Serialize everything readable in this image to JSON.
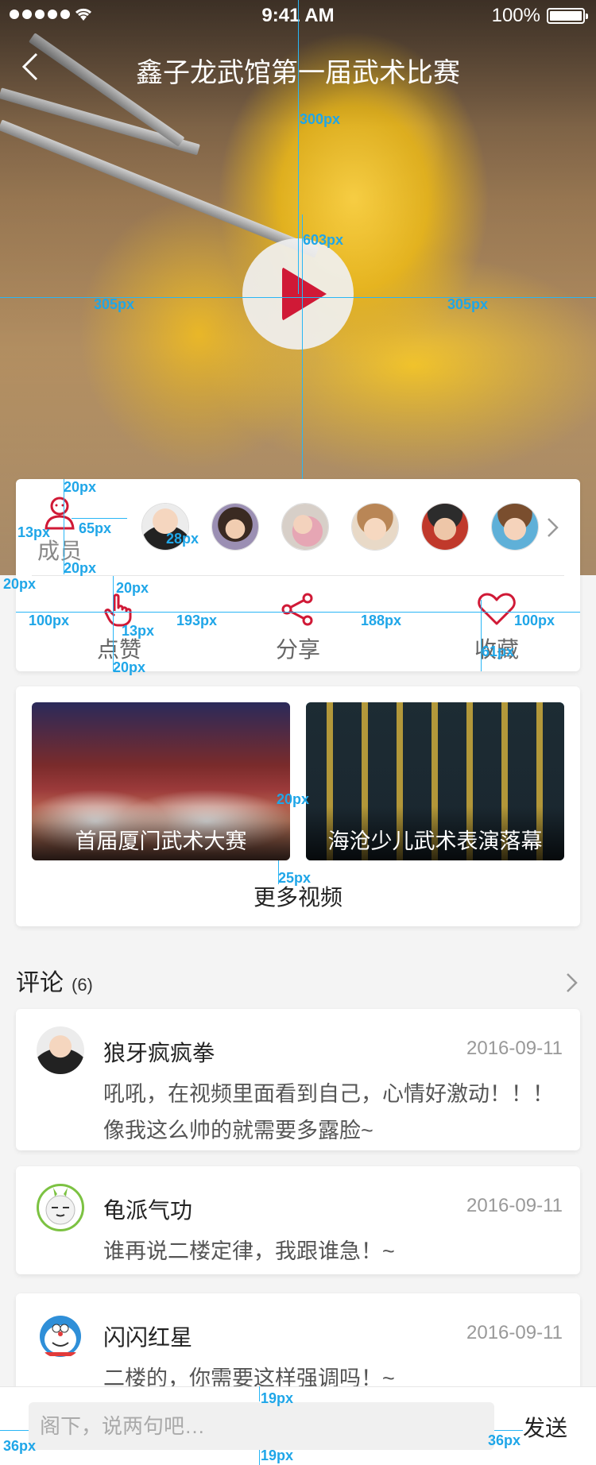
{
  "statusbar": {
    "time": "9:41 AM",
    "battery": "100%"
  },
  "navbar": {
    "title": "鑫子龙武馆第一届武术比赛"
  },
  "members": {
    "label": "成员",
    "avatar_count": 6
  },
  "actions": {
    "like": "点赞",
    "share": "分享",
    "favorite": "收藏"
  },
  "videos": {
    "items": [
      {
        "caption": "首届厦门武术大赛"
      },
      {
        "caption": "海沧少儿武术表演落幕"
      }
    ],
    "more": "更多视频"
  },
  "comments": {
    "title": "评论",
    "count": "(6)",
    "items": [
      {
        "name": "狼牙疯疯拳",
        "date": "2016-09-11",
        "text": "吼吼，在视频里面看到自己，心情好激动！！！像我这么帅的就需要多露脸~"
      },
      {
        "name": "龟派气功",
        "date": "2016-09-11",
        "text": "谁再说二楼定律，我跟谁急！~"
      },
      {
        "name": "闪闪红星",
        "date": "2016-09-11",
        "text": "二楼的，你需要这样强调吗！~"
      }
    ]
  },
  "input_bar": {
    "placeholder": "阁下，说两句吧…",
    "send": "发送"
  },
  "measurements": {
    "m1": "300px",
    "m2": "603px",
    "m3": "305px",
    "m4": "305px",
    "m5": "20px",
    "m6": "13px",
    "m7": "65px",
    "m8": "28px",
    "m9": "20px",
    "m10": "20px",
    "m11": "20px",
    "m12": "100px",
    "m13": "13px",
    "m14": "193px",
    "m15": "188px",
    "m16": "100px",
    "m17": "20px",
    "m18": "61px",
    "m19": "20px",
    "m20": "25px",
    "m21": "19px",
    "m22": "36px",
    "m23": "36px",
    "m24": "19px"
  },
  "colors": {
    "accent": "#d01936",
    "measure": "#29b6f6"
  }
}
